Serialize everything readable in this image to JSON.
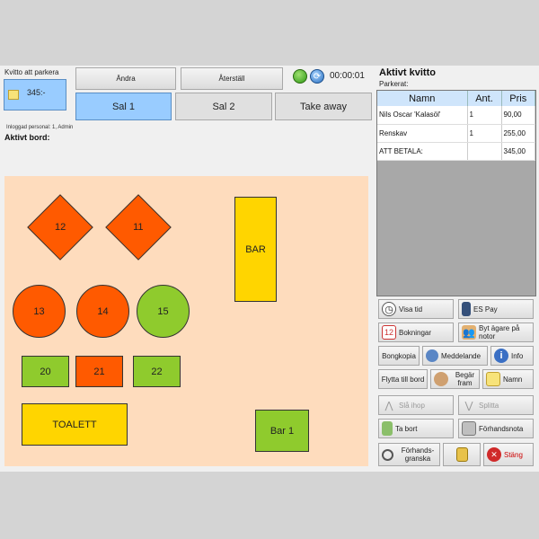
{
  "parking": {
    "title": "Kvitto att parkera",
    "amount": "345:-"
  },
  "toolbar": {
    "change_label": "Ändra",
    "reset_label": "Återställ",
    "timer": "00:00:01"
  },
  "tabs": [
    {
      "label": "Sal 1",
      "selected": true
    },
    {
      "label": "Sal 2",
      "selected": false
    },
    {
      "label": "Take away",
      "selected": false
    }
  ],
  "session": {
    "logged_in": "Inloggad personal: 1, Admin",
    "active_table_label": "Aktivt bord:"
  },
  "floor": {
    "tables": [
      {
        "label": "12",
        "shape": "diamond",
        "color": "#ff5a00"
      },
      {
        "label": "11",
        "shape": "diamond",
        "color": "#ff5a00"
      },
      {
        "label": "BAR",
        "shape": "rect",
        "color": "#ffd500"
      },
      {
        "label": "13",
        "shape": "circle",
        "color": "#ff5a00"
      },
      {
        "label": "14",
        "shape": "circle",
        "color": "#ff5a00"
      },
      {
        "label": "15",
        "shape": "circle",
        "color": "#8fcb2d"
      },
      {
        "label": "20",
        "shape": "rect",
        "color": "#8fcb2d"
      },
      {
        "label": "21",
        "shape": "rect",
        "color": "#ff5a00"
      },
      {
        "label": "22",
        "shape": "rect",
        "color": "#8fcb2d"
      },
      {
        "label": "TOALETT",
        "shape": "rect",
        "color": "#ffd500"
      },
      {
        "label": "Bar 1",
        "shape": "rect",
        "color": "#8fcb2d"
      }
    ]
  },
  "receipt": {
    "title": "Aktivt kvitto",
    "parked_label": "Parkerat:",
    "columns": [
      "Namn",
      "Ant.",
      "Pris"
    ],
    "rows": [
      {
        "name": "Nils Oscar 'Kalasöl'",
        "qty": "1",
        "price": "90,00"
      },
      {
        "name": "Renskav",
        "qty": "1",
        "price": "255,00"
      },
      {
        "name": "ATT BETALA:",
        "qty": "",
        "price": "345,00"
      }
    ]
  },
  "actions": {
    "show_time": "Visa tid",
    "es_pay": "ES Pay",
    "bookings": "Bokningar",
    "change_owner": "Byt ägare på notor",
    "bong_copy": "Bongkopia",
    "message": "Meddelande",
    "info": "Info",
    "move_table": "Flytta till bord",
    "request": "Begär fram",
    "name": "Namn",
    "merge": "Slå ihop",
    "split": "Splitta",
    "remove": "Ta bort",
    "hand_note": "Förhandsnota",
    "preview": "Förhands-granska",
    "close": "Stäng"
  }
}
